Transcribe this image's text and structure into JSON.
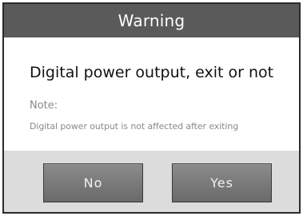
{
  "dialog": {
    "title": "Warning",
    "message": "Digital power output, exit or not",
    "note_label": "Note:",
    "note_text": "Digital power output is not affected after exiting",
    "buttons": {
      "no_label": "No",
      "yes_label": "Yes"
    }
  },
  "colors": {
    "titlebar_bg": "#5a5a5a",
    "content_bg": "#ffffff",
    "buttonbar_bg": "#dcdcdc",
    "button_bg": "#7a7a7a",
    "note_text": "#8a8a8a"
  }
}
